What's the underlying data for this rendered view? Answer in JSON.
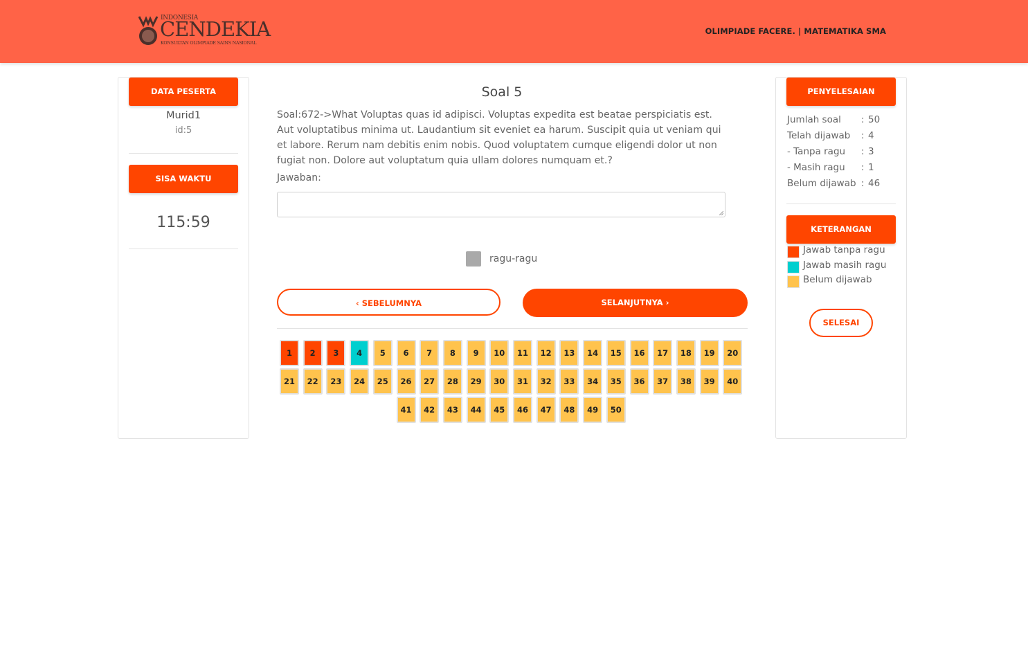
{
  "header": {
    "logo": {
      "top": "INDONESIA",
      "main": "CENDEKIA",
      "sub": "KONSULTAN OLIMPIADE SAINS NASIONAL"
    },
    "title": "OLIMPIADE FACERE. | MATEMATIKA SMA",
    "bg_color": "#ff6347"
  },
  "left": {
    "participant_heading": "DATA PESERTA",
    "participant_name": "Murid1",
    "participant_id": "id:5",
    "timer_heading": "SISA WAKTU",
    "timer_value": "115:59"
  },
  "question": {
    "title": "Soal 5",
    "text": "Soal:672->What Voluptas quas id adipisci. Voluptas expedita est beatae perspiciatis est. Aut voluptatibus minima ut. Laudantium sit eveniet ea harum. Suscipit quia ut veniam qui et labore. Rerum nam debitis enim nobis. Quod voluptatem cumque eligendi dolor ut non fugiat non. Dolore aut voluptatum quia ullam dolores numquam et.?",
    "answer_label": "Jawaban:",
    "answer_value": "",
    "doubt_label": "ragu-ragu",
    "prev_label": "SEBELUMNYA",
    "next_label": "SELANJUTNYA"
  },
  "colors": {
    "answered": "#ff4500",
    "doubt": "#00cfcf",
    "unanswered": "#ffc34d",
    "accent": "#ff4500"
  },
  "question_numbers": [
    {
      "n": "1",
      "status": "answered"
    },
    {
      "n": "2",
      "status": "answered"
    },
    {
      "n": "3",
      "status": "answered"
    },
    {
      "n": "4",
      "status": "doubt"
    },
    {
      "n": "5",
      "status": "unanswered"
    },
    {
      "n": "6",
      "status": "unanswered"
    },
    {
      "n": "7",
      "status": "unanswered"
    },
    {
      "n": "8",
      "status": "unanswered"
    },
    {
      "n": "9",
      "status": "unanswered"
    },
    {
      "n": "10",
      "status": "unanswered"
    },
    {
      "n": "11",
      "status": "unanswered"
    },
    {
      "n": "12",
      "status": "unanswered"
    },
    {
      "n": "13",
      "status": "unanswered"
    },
    {
      "n": "14",
      "status": "unanswered"
    },
    {
      "n": "15",
      "status": "unanswered"
    },
    {
      "n": "16",
      "status": "unanswered"
    },
    {
      "n": "17",
      "status": "unanswered"
    },
    {
      "n": "18",
      "status": "unanswered"
    },
    {
      "n": "19",
      "status": "unanswered"
    },
    {
      "n": "20",
      "status": "unanswered"
    },
    {
      "n": "21",
      "status": "unanswered"
    },
    {
      "n": "22",
      "status": "unanswered"
    },
    {
      "n": "23",
      "status": "unanswered"
    },
    {
      "n": "24",
      "status": "unanswered"
    },
    {
      "n": "25",
      "status": "unanswered"
    },
    {
      "n": "26",
      "status": "unanswered"
    },
    {
      "n": "27",
      "status": "unanswered"
    },
    {
      "n": "28",
      "status": "unanswered"
    },
    {
      "n": "29",
      "status": "unanswered"
    },
    {
      "n": "30",
      "status": "unanswered"
    },
    {
      "n": "31",
      "status": "unanswered"
    },
    {
      "n": "32",
      "status": "unanswered"
    },
    {
      "n": "33",
      "status": "unanswered"
    },
    {
      "n": "34",
      "status": "unanswered"
    },
    {
      "n": "35",
      "status": "unanswered"
    },
    {
      "n": "36",
      "status": "unanswered"
    },
    {
      "n": "37",
      "status": "unanswered"
    },
    {
      "n": "38",
      "status": "unanswered"
    },
    {
      "n": "39",
      "status": "unanswered"
    },
    {
      "n": "40",
      "status": "unanswered"
    },
    {
      "n": "41",
      "status": "unanswered"
    },
    {
      "n": "42",
      "status": "unanswered"
    },
    {
      "n": "43",
      "status": "unanswered"
    },
    {
      "n": "44",
      "status": "unanswered"
    },
    {
      "n": "45",
      "status": "unanswered"
    },
    {
      "n": "46",
      "status": "unanswered"
    },
    {
      "n": "47",
      "status": "unanswered"
    },
    {
      "n": "48",
      "status": "unanswered"
    },
    {
      "n": "49",
      "status": "unanswered"
    },
    {
      "n": "50",
      "status": "unanswered"
    }
  ],
  "right": {
    "progress_heading": "PENYELESAIAN",
    "stats": [
      {
        "label": "Jumlah soal",
        "value": "50"
      },
      {
        "label": "Telah dijawab",
        "value": "4"
      },
      {
        "label": "- Tanpa ragu",
        "value": "3"
      },
      {
        "label": "- Masih ragu",
        "value": "1"
      },
      {
        "label": "Belum dijawab",
        "value": "46"
      }
    ],
    "legend_heading": "KETERANGAN",
    "legend": [
      {
        "label": "Jawab tanpa ragu",
        "status": "answered"
      },
      {
        "label": "Jawab masih ragu",
        "status": "doubt"
      },
      {
        "label": "Belum dijawab",
        "status": "unanswered"
      }
    ],
    "finish_label": "SELESAI"
  }
}
